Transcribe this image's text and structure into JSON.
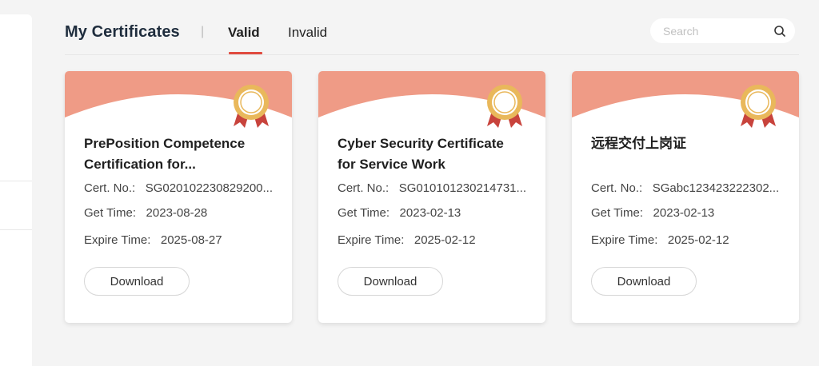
{
  "header": {
    "title": "My Certificates",
    "separator": "|"
  },
  "tabs": [
    {
      "label": "Valid",
      "active": true
    },
    {
      "label": "Invalid",
      "active": false
    }
  ],
  "search": {
    "placeholder": "Search",
    "value": "",
    "icon": "search-icon"
  },
  "colors": {
    "accent": "#e04b3f",
    "card_header": "#ef9b86",
    "medal_gold": "#e9b85b",
    "ribbon": "#c8433c"
  },
  "cards": [
    {
      "title_line1": "PrePosition Competence",
      "title_line2": "Certification for...",
      "cert_label": "Cert. No.:",
      "cert_no": "SG020102230829200...",
      "get_label": "Get Time:",
      "get_time": "2023-08-28",
      "expire_label": "Expire Time:",
      "expire_time": "2025-08-27",
      "download": "Download"
    },
    {
      "title_line1": "Cyber Security Certificate",
      "title_line2": "for Service Work",
      "cert_label": "Cert. No.:",
      "cert_no": "SG010101230214731...",
      "get_label": "Get Time:",
      "get_time": "2023-02-13",
      "expire_label": "Expire Time:",
      "expire_time": "2025-02-12",
      "download": "Download"
    },
    {
      "title_line1": "远程交付上岗证",
      "title_line2": "",
      "cert_label": "Cert. No.:",
      "cert_no": "SGabc123423222302...",
      "get_label": "Get Time:",
      "get_time": "2023-02-13",
      "expire_label": "Expire Time:",
      "expire_time": "2025-02-12",
      "download": "Download"
    }
  ]
}
